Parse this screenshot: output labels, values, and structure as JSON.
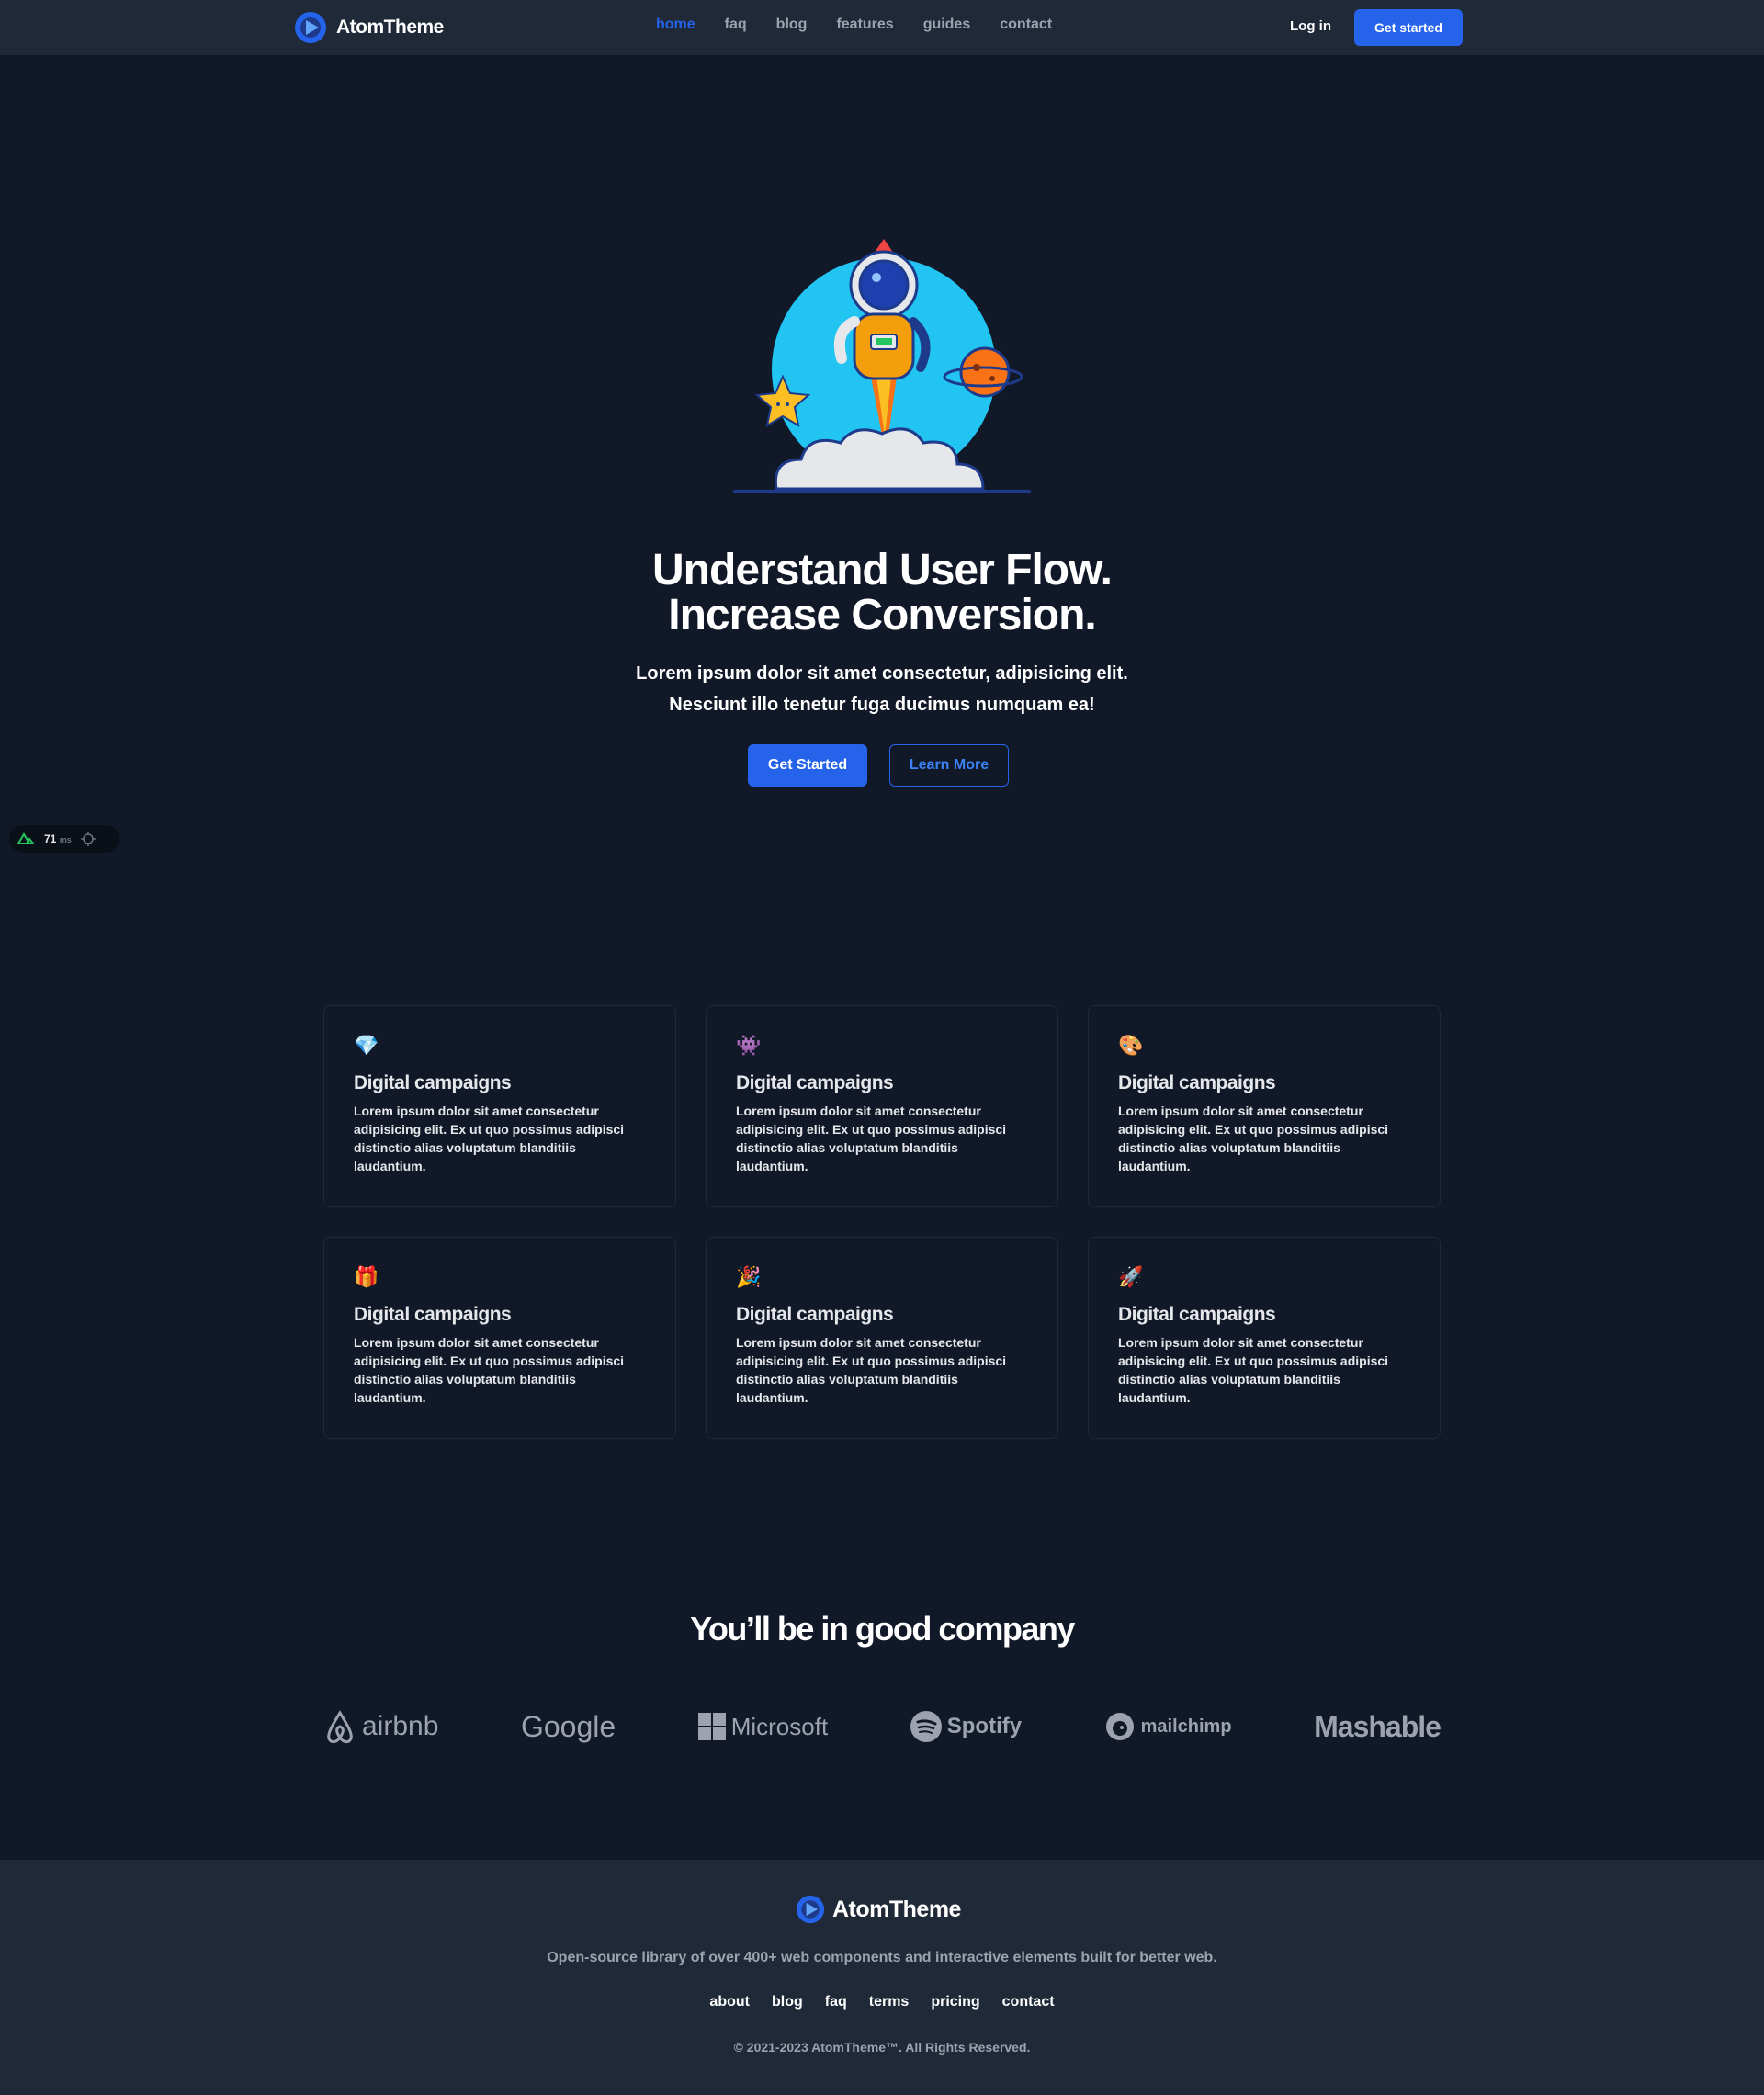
{
  "nav": {
    "brand": "AtomTheme",
    "links": [
      "home",
      "faq",
      "blog",
      "features",
      "guides",
      "contact"
    ],
    "login": "Log in",
    "cta": "Get started"
  },
  "hero": {
    "title_line1": "Understand User Flow.",
    "title_line2": "Increase Conversion.",
    "sub_line1": "Lorem ipsum dolor sit amet consectetur, adipisicing elit.",
    "sub_line2": "Nesciunt illo tenetur fuga ducimus numquam ea!",
    "primary_cta": "Get Started",
    "secondary_cta": "Learn More"
  },
  "devtools": {
    "value": "71",
    "unit": "ms"
  },
  "features": [
    {
      "icon": "gem-icon",
      "emoji": "💎",
      "title": "Digital campaigns",
      "text": "Lorem ipsum dolor sit amet consectetur adipisicing elit. Ex ut quo possimus adipisci distinctio alias voluptatum blanditiis laudantium."
    },
    {
      "icon": "alien-monster-icon",
      "emoji": "👾",
      "title": "Digital campaigns",
      "text": "Lorem ipsum dolor sit amet consectetur adipisicing elit. Ex ut quo possimus adipisci distinctio alias voluptatum blanditiis laudantium."
    },
    {
      "icon": "palette-icon",
      "emoji": "🎨",
      "title": "Digital campaigns",
      "text": "Lorem ipsum dolor sit amet consectetur adipisicing elit. Ex ut quo possimus adipisci distinctio alias voluptatum blanditiis laudantium."
    },
    {
      "icon": "gift-icon",
      "emoji": "🎁",
      "title": "Digital campaigns",
      "text": "Lorem ipsum dolor sit amet consectetur adipisicing elit. Ex ut quo possimus adipisci distinctio alias voluptatum blanditiis laudantium."
    },
    {
      "icon": "party-popper-icon",
      "emoji": "🎉",
      "title": "Digital campaigns",
      "text": "Lorem ipsum dolor sit amet consectetur adipisicing elit. Ex ut quo possimus adipisci distinctio alias voluptatum blanditiis laudantium."
    },
    {
      "icon": "rocket-icon",
      "emoji": "🚀",
      "title": "Digital campaigns",
      "text": "Lorem ipsum dolor sit amet consectetur adipisicing elit. Ex ut quo possimus adipisci distinctio alias voluptatum blanditiis laudantium."
    }
  ],
  "company": {
    "title": "You’ll be in good company",
    "logos": [
      "airbnb",
      "Google",
      "Microsoft",
      "Spotify",
      "mailchimp",
      "Mashable"
    ]
  },
  "footer": {
    "brand": "AtomTheme",
    "description": "Open-source library of over 400+ web components and interactive elements built for better web.",
    "links": [
      "about",
      "blog",
      "faq",
      "terms",
      "pricing",
      "contact"
    ],
    "copyright": "© 2021-2023 AtomTheme™. All Rights Reserved."
  },
  "colors": {
    "background": "#111827",
    "surface": "#1f2937",
    "accent": "#2563eb",
    "muted": "#9ca3af"
  }
}
